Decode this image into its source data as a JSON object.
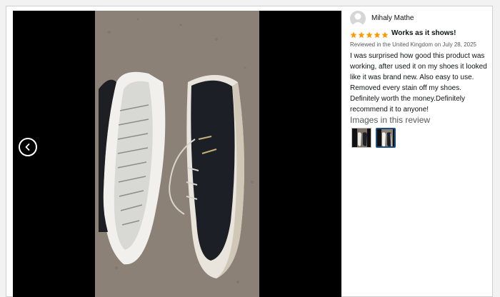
{
  "review": {
    "reviewer_name": "Mihaly Mathe",
    "rating": 5,
    "title": "Works as it shows!",
    "meta": "Reviewed in the United Kingdom on July 28, 2025",
    "body": "I was surprised how good this product was working, after used it on my shoes it looked like it was brand new. Also easy to use. Removed every stain off my shoes. Definitely worth the money.Definitely recommend it to anyone!"
  },
  "images_section": {
    "heading": "Images in this review",
    "thumbnails": [
      {
        "icon": "sneaker-before-thumbnail",
        "selected": false
      },
      {
        "icon": "sneaker-after-thumbnail",
        "selected": true
      }
    ]
  },
  "viewer": {
    "prev_icon": "chevron-left-icon",
    "image": "shoes-photo"
  },
  "colors": {
    "star": "#ff9900",
    "link_selected_border": "#1b4f82",
    "text_primary": "#0f1111",
    "text_secondary": "#565959"
  }
}
